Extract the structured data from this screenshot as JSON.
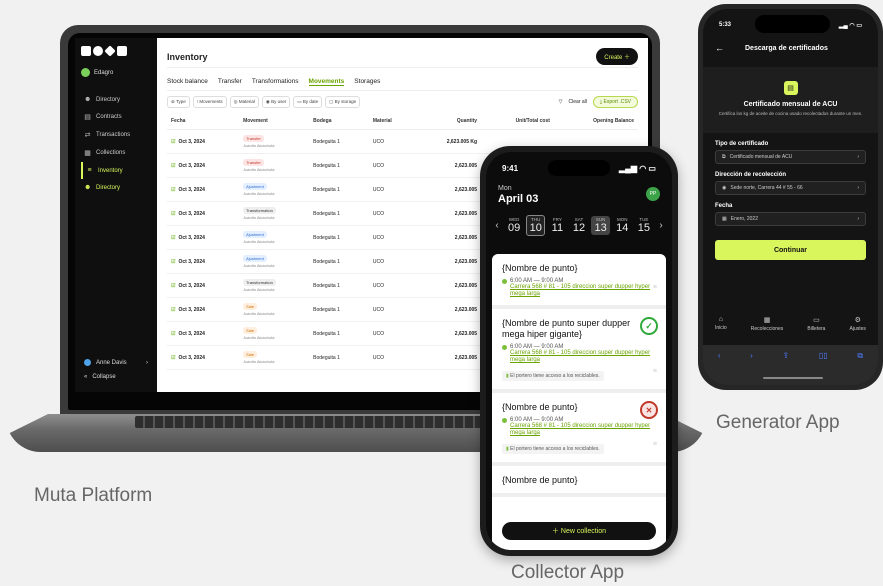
{
  "captions": {
    "platform": "Muta Platform",
    "collector": "Collector App",
    "generator": "Generator App"
  },
  "platform": {
    "sidebar": {
      "org": "Edagro",
      "items": [
        {
          "label": "Directory",
          "icon": "users-icon"
        },
        {
          "label": "Contracts",
          "icon": "document-icon"
        },
        {
          "label": "Transactions",
          "icon": "arrows-icon"
        },
        {
          "label": "Collections",
          "icon": "calendar-icon"
        },
        {
          "label": "Inventory",
          "icon": "list-icon"
        },
        {
          "label": "Directory",
          "icon": "users-icon"
        }
      ],
      "user": "Anne Davis",
      "collapse": "Collapse"
    },
    "title": "Inventory",
    "create_label": "Create",
    "tabs": [
      "Stock balance",
      "Transfer",
      "Transformations",
      "Movements",
      "Storages"
    ],
    "active_tab": "Movements",
    "filters": [
      "Type",
      "Movements",
      "Material",
      "By user",
      "By date",
      "By storage"
    ],
    "clear_all": "Clear all",
    "export": "Export .CSV",
    "columns": [
      "Fecha",
      "Movement",
      "Bodega",
      "Material",
      "Quantity",
      "Unit/Total cost",
      "Opening Balance"
    ],
    "rows": [
      {
        "date": "Oct 3, 2024",
        "type": "Transfer",
        "kind": "transfer",
        "user": "Juanito Alcachofa",
        "bodega": "Bodeguita 1",
        "material": "UCO",
        "qty": "2,623.005 Kg",
        "cost": "",
        "opening": ""
      },
      {
        "date": "Oct 3, 2024",
        "type": "Transfer",
        "kind": "transfer",
        "user": "Juanito Alcachofa",
        "bodega": "Bodeguita 1",
        "material": "UCO",
        "qty": "2,623.005",
        "cost": "",
        "opening": ""
      },
      {
        "date": "Oct 3, 2024",
        "type": "Ajustment",
        "kind": "adjustment",
        "user": "Juanito Alcachofa",
        "bodega": "Bodeguita 1",
        "material": "UCO",
        "qty": "2,623.005",
        "cost": "",
        "opening": ""
      },
      {
        "date": "Oct 3, 2024",
        "type": "Transformation",
        "kind": "transformation",
        "user": "Juanito Alcachofa",
        "bodega": "Bodeguita 1",
        "material": "UCO",
        "qty": "2,623.005",
        "cost": "",
        "opening": ""
      },
      {
        "date": "Oct 3, 2024",
        "type": "Ajustment",
        "kind": "adjustment",
        "user": "Juanito Alcachofa",
        "bodega": "Bodeguita 1",
        "material": "UCO",
        "qty": "2,623.005",
        "cost": "",
        "opening": ""
      },
      {
        "date": "Oct 3, 2024",
        "type": "Ajustment",
        "kind": "adjustment",
        "user": "Juanito Alcachofa",
        "bodega": "Bodeguita 1",
        "material": "UCO",
        "qty": "2,623.005",
        "cost": "",
        "opening": ""
      },
      {
        "date": "Oct 3, 2024",
        "type": "Transformation",
        "kind": "transformation",
        "user": "Juanito Alcachofa",
        "bodega": "Bodeguita 1",
        "material": "UCO",
        "qty": "2,623.005",
        "cost": "",
        "opening": ""
      },
      {
        "date": "Oct 3, 2024",
        "type": "Sale",
        "kind": "sale",
        "user": "Juanito Alcachofa",
        "bodega": "Bodeguita 1",
        "material": "UCO",
        "qty": "2,623.005",
        "cost": "",
        "opening": ""
      },
      {
        "date": "Oct 3, 2024",
        "type": "Sale",
        "kind": "sale",
        "user": "Juanito Alcachofa",
        "bodega": "Bodeguita 1",
        "material": "UCO",
        "qty": "2,623.005",
        "cost": "",
        "opening": ""
      },
      {
        "date": "Oct 3, 2024",
        "type": "Sale",
        "kind": "sale",
        "user": "Juanito Alcachofa",
        "bodega": "Bodeguita 1",
        "material": "UCO",
        "qty": "2,623.005",
        "cost": "",
        "opening": ""
      }
    ]
  },
  "collector": {
    "time": "9:41",
    "day_of_week": "Mon",
    "date": "April 03",
    "avatar": "PP",
    "week": [
      {
        "name": "WED",
        "num": "09"
      },
      {
        "name": "THU",
        "num": "10"
      },
      {
        "name": "FRY",
        "num": "11"
      },
      {
        "name": "SAT",
        "num": "12"
      },
      {
        "name": "SUN",
        "num": "13"
      },
      {
        "name": "MON",
        "num": "14"
      },
      {
        "name": "TUE",
        "num": "15"
      }
    ],
    "cards": [
      {
        "title": "{Nombre de punto}",
        "time": "6:00 AM  —  9:00 AM",
        "address": "Carrera 568 # 81 - 105 direccion super dupper hyper mega larga",
        "note": "",
        "status": ""
      },
      {
        "title": "{Nombre de punto super dupper mega hiper gigante}",
        "time": "6:00 AM  —  9:00 AM",
        "address": "Carrera 568 # 81 - 105 direccion super dupper hyper mega larga",
        "note": "El portero tiene acceso a los reciclables.",
        "status": "ok"
      },
      {
        "title": "{Nombre de punto}",
        "time": "6:00 AM  —  9:00 AM",
        "address": "Carrera 568 # 81 - 105 direccion super dupper hyper mega larga",
        "note": "El portero tiene acceso a los reciclables.",
        "status": "bad"
      },
      {
        "title": "{Nombre de punto}",
        "time": "",
        "address": "",
        "note": "",
        "status": ""
      }
    ],
    "new_collection": "New collection"
  },
  "generator": {
    "time": "5:33",
    "header": "Descarga de certificados",
    "hero_title": "Certificado mensual de ACU",
    "hero_sub": "Certifica los kg de aceite de cocina usado recolectados durante un mes.",
    "cert_label": "Tipo de certificado",
    "cert_value": "Certificado mensual de ACU",
    "addr_label": "Dirección de recolección",
    "addr_value": "Sede norte, Carrera 44 # 55 - 66",
    "date_label": "Fecha",
    "date_value": "Enero, 2022",
    "cta": "Continuar",
    "nav": [
      "Inicio",
      "Recolecciones",
      "Billetera",
      "Ajustes"
    ]
  }
}
